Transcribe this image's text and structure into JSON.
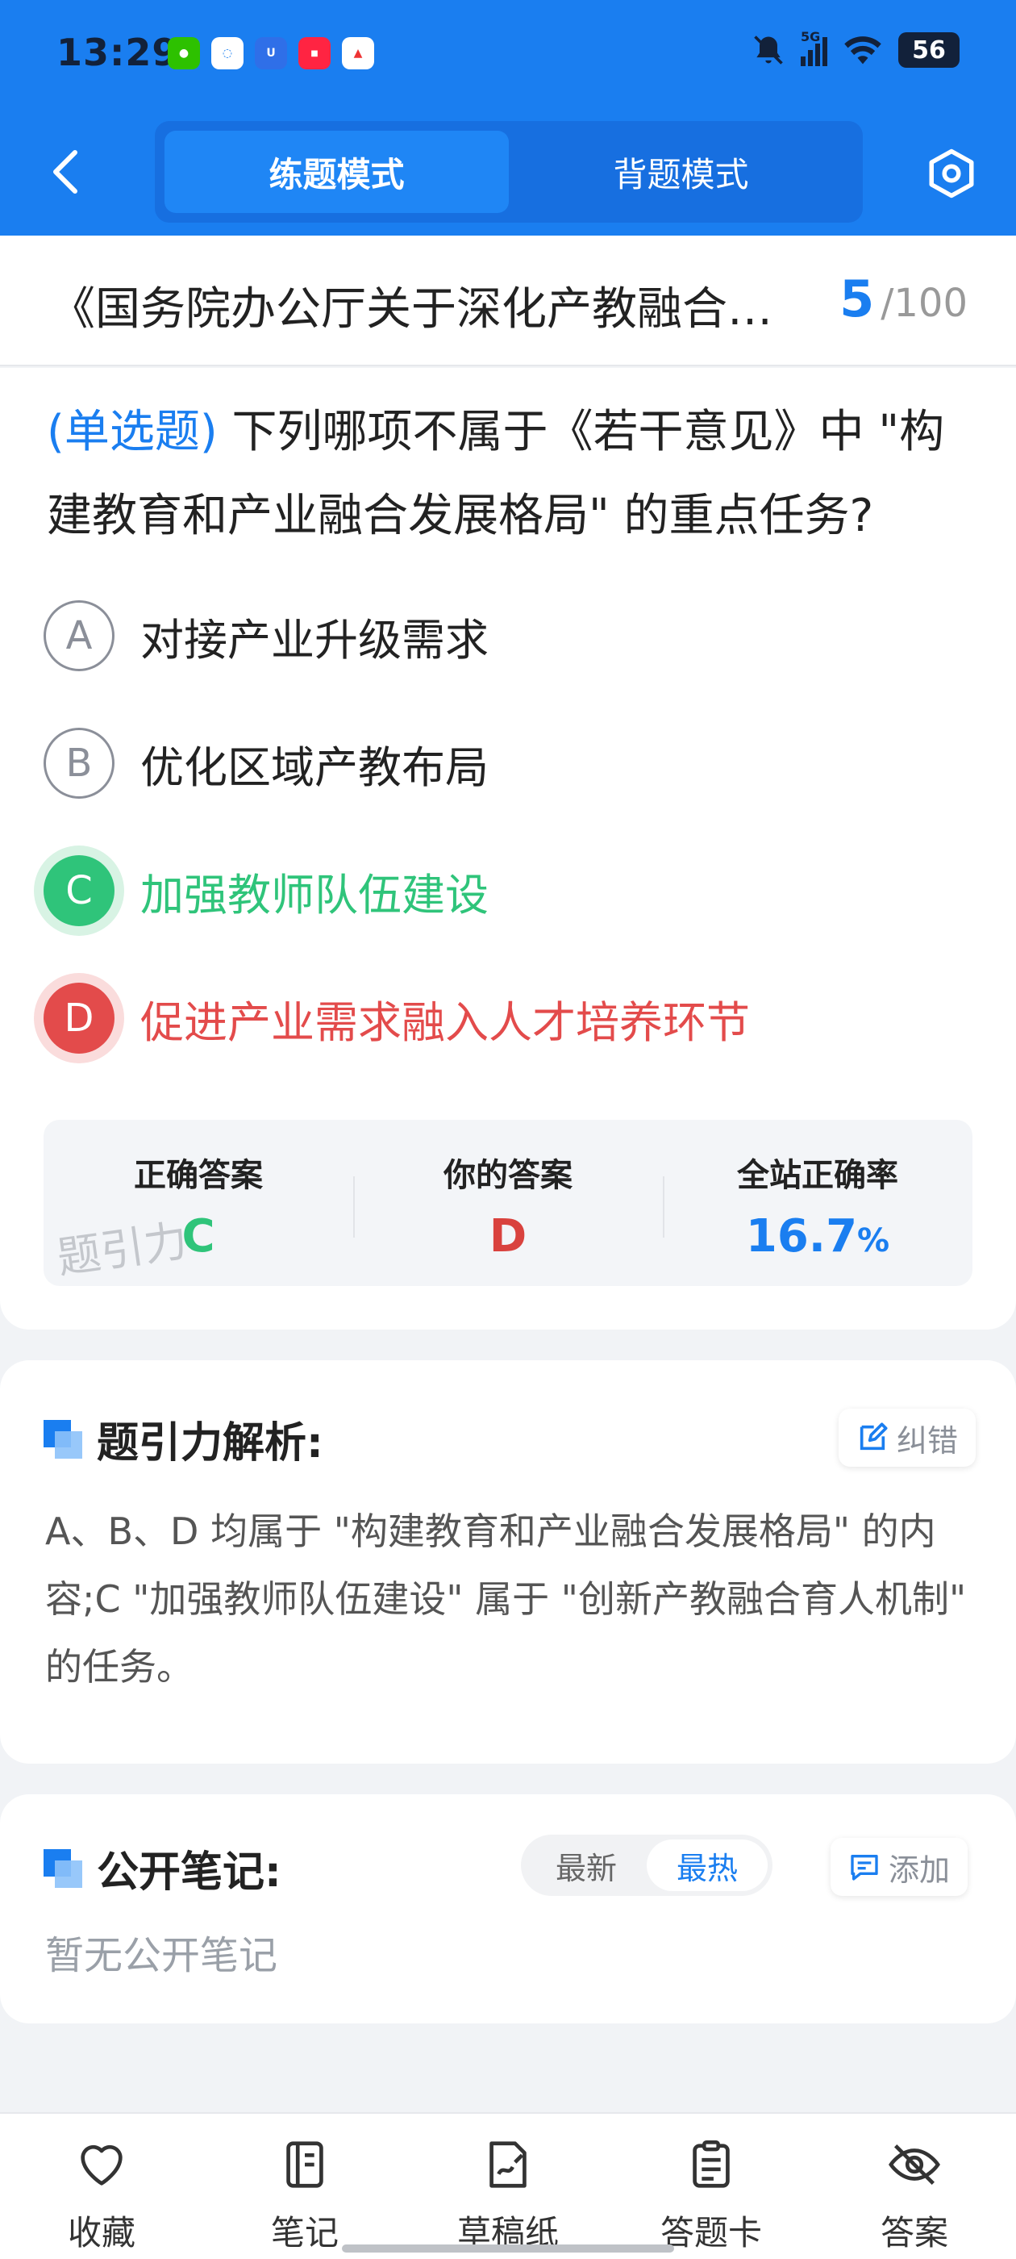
{
  "status_bar": {
    "time": "13:29",
    "network": "5G",
    "battery": "56"
  },
  "header": {
    "modes": [
      "练题模式",
      "背题模式"
    ],
    "active_mode": "练题模式"
  },
  "doc": {
    "title": "《国务院办公厅关于深化产教融合若干意见》",
    "current": "5",
    "total": "/100"
  },
  "question": {
    "type_tag": "(单选题)",
    "text": "下列哪项不属于《若干意见》中 \"构建教育和产业融合发展格局\" 的重点任务?",
    "options": [
      {
        "letter": "A",
        "text": "对接产业升级需求",
        "state": "normal"
      },
      {
        "letter": "B",
        "text": "优化区域产教布局",
        "state": "normal"
      },
      {
        "letter": "C",
        "text": "加强教师队伍建设",
        "state": "correct"
      },
      {
        "letter": "D",
        "text": "促进产业需求融入人才培养环节",
        "state": "wrong"
      }
    ]
  },
  "answer_summary": {
    "correct_label": "正确答案",
    "correct_value": "C",
    "yours_label": "你的答案",
    "yours_value": "D",
    "rate_label": "全站正确率",
    "rate_value": "16.7",
    "rate_unit": "%",
    "watermark": "题引力"
  },
  "analysis": {
    "title": "题引力解析:",
    "correct_button": "纠错",
    "text": "A、B、D 均属于 \"构建教育和产业融合发展格局\" 的内容;C \"加强教师队伍建设\" 属于 \"创新产教融合育人机制\" 的任务。"
  },
  "notes": {
    "title": "公开笔记:",
    "sort_options": [
      "最新",
      "最热"
    ],
    "active_sort": "最热",
    "add_button": "添加",
    "empty_text": "暂无公开笔记"
  },
  "bottom_nav": [
    {
      "label": "收藏",
      "icon": "heart-icon"
    },
    {
      "label": "笔记",
      "icon": "notebook-icon"
    },
    {
      "label": "草稿纸",
      "icon": "draft-icon"
    },
    {
      "label": "答题卡",
      "icon": "answer-card-icon"
    },
    {
      "label": "答案",
      "icon": "eye-off-icon"
    }
  ],
  "colors": {
    "primary": "#1a7ef0",
    "correct": "#2fc47a",
    "wrong": "#e34b4b"
  }
}
